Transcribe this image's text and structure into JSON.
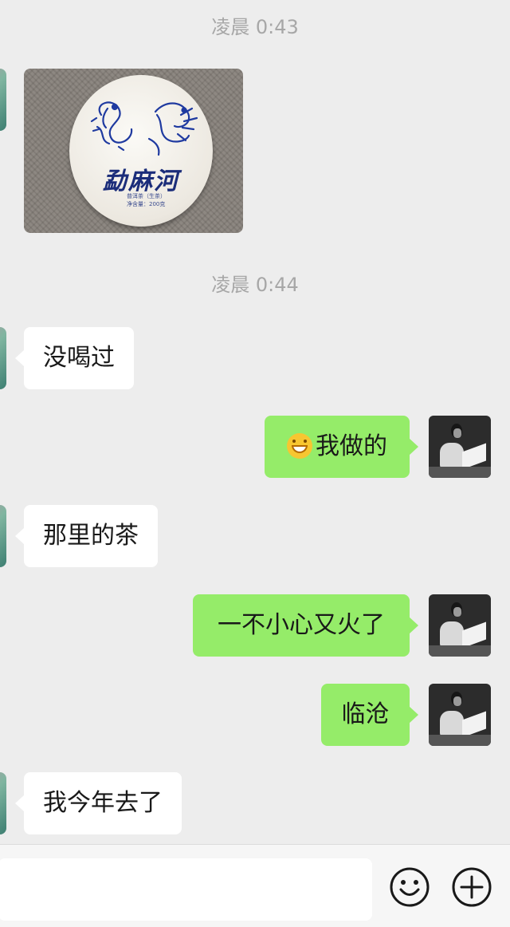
{
  "messages": {
    "ts1": "凌晨 0:43",
    "ts2": "凌晨 0:44",
    "photo": {
      "title": "勐麻河",
      "small_line1": "普洱茶（生茶）",
      "small_line2": "净含量：200克"
    },
    "m1": "没喝过",
    "m2": "我做的",
    "m3": "那里的茶",
    "m4": "一不小心又火了",
    "m5": "临沧",
    "m6": "我今年去了"
  },
  "input": {
    "placeholder": ""
  },
  "icons": {
    "emoji_button": "smiley-icon",
    "more_button": "plus-circle-icon"
  },
  "colors": {
    "background": "#ededed",
    "bubble_self": "#95ec69",
    "bubble_other": "#ffffff",
    "timestamp": "#a7a7a7"
  }
}
